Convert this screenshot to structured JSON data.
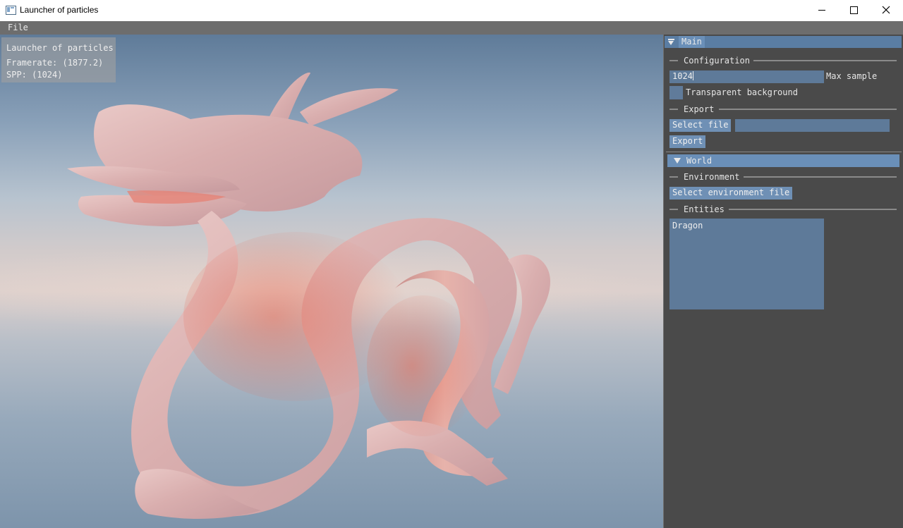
{
  "window": {
    "title": "Launcher of particles",
    "icons": {
      "app": "app-window-icon",
      "minimize": "minimize-icon",
      "maximize": "maximize-icon",
      "close": "close-icon"
    }
  },
  "menu": {
    "file": "File"
  },
  "viewport": {
    "overlay": {
      "title": "Launcher of particles",
      "framerate": "Framerate: (1877.2)",
      "spp": "SPP: (1024)"
    }
  },
  "panel": {
    "main_tab": "Main",
    "configuration": {
      "title": "Configuration",
      "max_sample_value": "1024",
      "max_sample_label": "Max sample",
      "transparent_label": "Transparent background",
      "transparent_checked": false
    },
    "export": {
      "title": "Export",
      "select_file_label": "Select file",
      "path_value": "",
      "export_label": "Export"
    },
    "world": {
      "title": "World",
      "environment_title": "Environment",
      "select_env_label": "Select environment file",
      "entities_title": "Entities",
      "entities": [
        "Dragon"
      ]
    }
  },
  "colors": {
    "panel_bg": "#4a4a4a",
    "accent": "#6f90b5",
    "menubar": "#6d6d6d"
  }
}
